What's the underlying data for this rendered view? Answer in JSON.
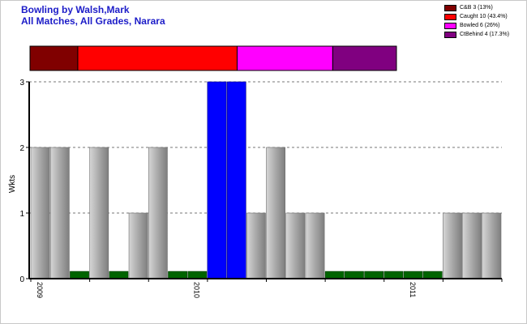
{
  "header": {
    "title_line1": "Bowling by Walsh,Mark",
    "title_line2": "All Matches, All Grades, Narara"
  },
  "legend": {
    "items": [
      {
        "label": "C&B 3 (13%)",
        "color": "#800000"
      },
      {
        "label": "Caught 10 (43.4%)",
        "color": "#ff0000"
      },
      {
        "label": "Bowled 6 (26%)",
        "color": "#ff00ff"
      },
      {
        "label": "CtBehind 4 (17.3%)",
        "color": "#800080"
      }
    ]
  },
  "chart_data": [
    {
      "type": "bar",
      "orientation": "horizontal-stacked",
      "series": [
        {
          "name": "C&B",
          "values": [
            3
          ],
          "color": "#800000"
        },
        {
          "name": "Caught",
          "values": [
            10
          ],
          "color": "#ff0000"
        },
        {
          "name": "Bowled",
          "values": [
            6
          ],
          "color": "#ff00ff"
        },
        {
          "name": "CtBehind",
          "values": [
            4
          ],
          "color": "#800080"
        }
      ]
    },
    {
      "type": "bar",
      "ylabel": "Wkts",
      "xlabel": "",
      "ylim": [
        0,
        3
      ],
      "yticks": [
        0,
        1,
        2,
        3
      ],
      "grid": true,
      "x_tick_labels": [
        {
          "label": "2009",
          "at_index": 0
        },
        {
          "label": "2010",
          "at_index": 8
        },
        {
          "label": "2011",
          "at_index": 19
        }
      ],
      "values": [
        2,
        2,
        0,
        2,
        0,
        1,
        2,
        0,
        0,
        3,
        3,
        1,
        2,
        1,
        1,
        0,
        0,
        0,
        0,
        0,
        0,
        1,
        1,
        1
      ],
      "colors": {
        "normal": "#a0a0a0",
        "highlight": "#0000ff",
        "zero_marker": "#006400"
      },
      "highlight_indices": [
        9,
        10
      ]
    }
  ]
}
